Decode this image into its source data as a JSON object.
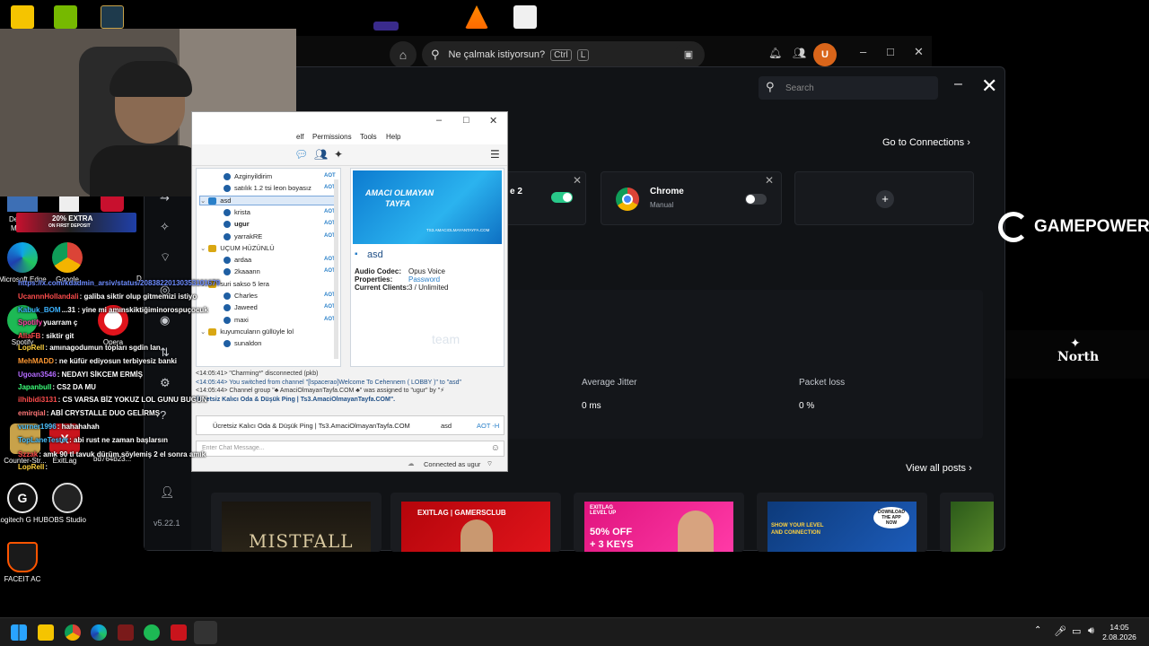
{
  "music": {
    "search_placeholder": "Ne çalmak istiyorsun?",
    "kbd_ctrl": "Ctrl",
    "kbd_key": "L",
    "avatar": "U"
  },
  "exitlag": {
    "search_placeholder": "Search",
    "goto": "Go to Connections",
    "card1_suffix": "e 2",
    "card2": {
      "title": "Chrome",
      "sub": "Manual"
    },
    "add": "+",
    "headers": [
      "Average Jitter",
      "Packet loss"
    ],
    "values": [
      "0 ms",
      "0 %"
    ],
    "view_all": "View all posts",
    "version": "v5.22.1",
    "post1_title": "MISTFALL",
    "post2_title": "EXITLAG | GAMERSCLUB",
    "post3_top": "EXITLAG LEVEL UP",
    "post3_line1": "50% OFF",
    "post3_line2": "+ 3 KEYS",
    "post4_badge": "DOWNLOAD THE APP NOW",
    "post4_line1": "SHOW YOUR LEVEL",
    "post4_line2": "AND CONNECTION"
  },
  "ts": {
    "menu": [
      "elf",
      "Permissions",
      "Tools",
      "Help"
    ],
    "tree": [
      {
        "type": "user",
        "name": "Azginyildirim",
        "badge": "AOT"
      },
      {
        "type": "user",
        "name": "satılık 1.2 tsi leon boyasız",
        "badge": "AOT"
      },
      {
        "type": "channel",
        "name": "asd",
        "badge": ""
      },
      {
        "type": "user",
        "name": "krista",
        "badge": "AOT"
      },
      {
        "type": "user",
        "name": "ugur",
        "badge": "AOT"
      },
      {
        "type": "user",
        "name": "yarrakRE",
        "badge": "AOT"
      },
      {
        "type": "channel-y",
        "name": "UÇUM HÜZÜNLÜ",
        "badge": ""
      },
      {
        "type": "user",
        "name": "ardaa",
        "badge": "AOT"
      },
      {
        "type": "user",
        "name": "2kaaann",
        "badge": "AOT"
      },
      {
        "type": "channel-y",
        "name": "suri sakso 5 lera",
        "badge": ""
      },
      {
        "type": "user",
        "name": "Charles",
        "badge": "AOT"
      },
      {
        "type": "user",
        "name": "Jaweed",
        "badge": "AOT"
      },
      {
        "type": "user",
        "name": "maxi",
        "badge": "AOT"
      },
      {
        "type": "channel-y",
        "name": "kuyumcuların güllüyle lol",
        "badge": ""
      },
      {
        "type": "user",
        "name": "sunaldon",
        "badge": ""
      }
    ],
    "banner_l1": "AMACI OLMAYAN",
    "banner_l2": "TAYFA",
    "banner_l3": "TS3.AMACIOLMAYANTAYFA.COM",
    "channel_name": "asd",
    "codec_label": "Audio Codec:",
    "codec_value": "Opus Voice",
    "prop_label": "Properties:",
    "prop_value": "Password",
    "clients_label": "Current Clients:",
    "clients_value": "3 / Unlimited",
    "watermark": "team",
    "log": [
      "<14:05:41> \"Charming*\" disconnected (pkb)",
      "<14:05:44> You switched from channel \"[lspacerao]Welcome To Cehennem ( LOBBY )\" to \"asd\"",
      "<14:05:44> Channel group \"♣ AmaciOlmayanTayfa.COM ♣\" was assigned to \"ugur\" by \"⚡",
      "Ücretsiz Kalıcı Oda & Düşük Ping | Ts3.AmaciOlmayanTayfa.COM\"."
    ],
    "tab1": "Ücretsiz Kalıcı Oda & Düşük Ping | Ts3.AmaciOlmayanTayfa.COM",
    "tab2": "asd",
    "tab3": "AOT -H",
    "chat_placeholder": "Enter Chat Message...",
    "status": "Connected as ugur"
  },
  "desktop": [
    {
      "label": "Microsoft Edge",
      "color": "#1677d2"
    },
    {
      "label": "Google",
      "color": "#e33b2e"
    },
    {
      "label": "Spotify",
      "color": "#1db954"
    },
    {
      "label": "Opera",
      "color": "#e1141c"
    },
    {
      "label": "Counter-Str...",
      "color": "#c8a24a"
    },
    {
      "label": "ExitLag",
      "color": "#c9141c"
    },
    {
      "label": "Logitech G HUB",
      "color": "#222"
    },
    {
      "label": "OBS Studio",
      "color": "#333"
    },
    {
      "label": "FACEIT AC",
      "color": "#ff5500"
    }
  ],
  "desktop_misc": {
    "tag1": "Desk",
    "tag2": "M",
    "tag3": "20% EXTRA",
    "tag4": "ON FIRST DEPOSIT",
    "d": "D",
    "bd": "bd764b23..."
  },
  "chat": [
    {
      "user": "https://x.com/kdadmin_arsiv/status/20838220130353101679",
      "msg": "",
      "color": "#6d8cff"
    },
    {
      "user": "UcannnHollandali",
      "msg": ": galiba siktir olup gitmemizi istiyo",
      "color": "#ff4d4d"
    },
    {
      "user": "Kabuk_BOM",
      "msg": "...31 : yine mi amınskiktiğiminorospuçocuk",
      "color": "#3cb3ff"
    },
    {
      "user": "Spotify",
      "msg": "yuarram ç",
      "color": "#ff3fa4"
    },
    {
      "user": "AliaFB",
      "msg": ": siktir git",
      "color": "#ff4d4d"
    },
    {
      "user": "LopRell",
      "msg": ": amınagodumun topları sgdin lan",
      "color": "#ffd23f"
    },
    {
      "user": "MehMADD",
      "msg": ": ne küfür ediyosun terbiyesiz banki",
      "color": "#ff9933"
    },
    {
      "user": "Ugoan3546",
      "msg": ": NEDAYI SİKCEM ERMİŞ",
      "color": "#b46bff"
    },
    {
      "user": "Japanbull",
      "msg": ": CS2 DA MU",
      "color": "#3cff7a"
    },
    {
      "user": "ilhibidi3131",
      "msg": ": CS VARSA BİZ YOKUZ LOL GUNU BUGUN",
      "color": "#ff4d4d"
    },
    {
      "user": "emirqial",
      "msg": ": ABİ CRYSTALLE DUO GELİRMŞ",
      "color": "#ff7777"
    },
    {
      "user": "vurner1996",
      "msg": ": hahahahah",
      "color": "#4dc3ff"
    },
    {
      "user": "TopLaneTester",
      "msg": ": abi rust ne zaman başlarsın",
      "color": "#4dc3ff"
    },
    {
      "user": "Szzak",
      "msg": ": amk 90 tl tavuk dürüm söylemiş 2 el sonra amık",
      "color": "#ff4d4d"
    },
    {
      "user": "LopRell",
      "msg": ":",
      "color": "#ffd23f"
    }
  ],
  "logos": {
    "gamepower": "GAMEPOWER",
    "north": "North"
  },
  "clock": {
    "time": "14:05",
    "date": "2.08.2026"
  }
}
